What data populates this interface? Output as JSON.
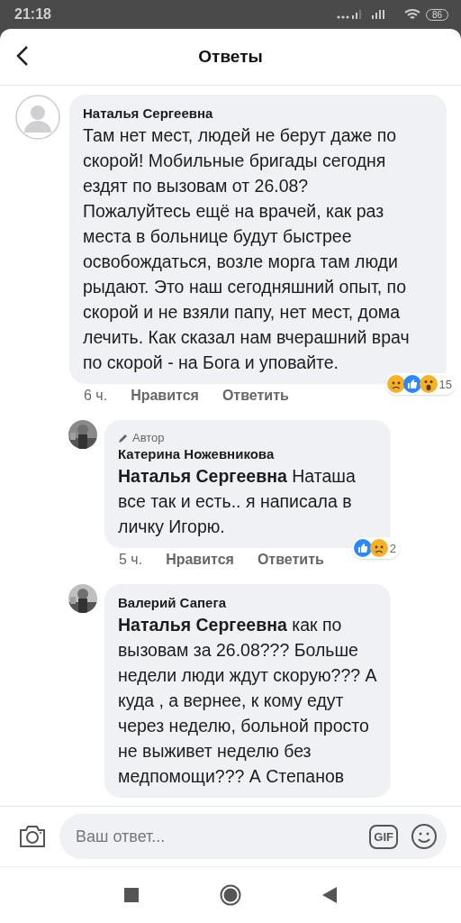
{
  "status_bar": {
    "time": "21:18",
    "battery": "86"
  },
  "header": {
    "title": "Ответы"
  },
  "comments": [
    {
      "kind": "comment",
      "name": "Наталья Сергеевна",
      "text": "Там нет мест, людей не берут даже по скорой! Мобильные бригады сегодня ездят по вызовам от 26.08? Пожалуйтесь ещё на врачей, как раз места в больнице будут быстрее освобождаться, возле морга там люди рыдают. Это наш сегодняшний опыт, по скорой и не взяли папу, нет мест, дома лечить. Как  сказал нам вчерашний врач по скорой - на Бога и уповайте.",
      "time": "6 ч.",
      "like": "Нравится",
      "answer": "Ответить",
      "reactions": [
        {
          "kind": "sad"
        },
        {
          "kind": "like"
        },
        {
          "kind": "wow"
        }
      ],
      "reaction_count": "15"
    },
    {
      "kind": "reply",
      "author_badge": "Автор",
      "name": "Катерина Ножевникова",
      "text": "**Наталья Сергеевна** Наташа все так и есть.. я написала в личку Игорю.",
      "time": "5 ч.",
      "like": "Нравится",
      "answer": "Ответить",
      "reactions": [
        {
          "kind": "like"
        },
        {
          "kind": "sad"
        }
      ],
      "reaction_count": "2"
    },
    {
      "kind": "reply",
      "name": "Валерий Сапега",
      "text": "**Наталья Сергеевна** как по вызовам за 26.08??? Больше недели люди ждут скорую??? А куда , а вернее,  к кому  едут через неделю, больной просто не выживет неделю без медпомощи??? А Степанов"
    }
  ],
  "composer": {
    "placeholder": "Ваш ответ...",
    "gif": "GIF"
  }
}
